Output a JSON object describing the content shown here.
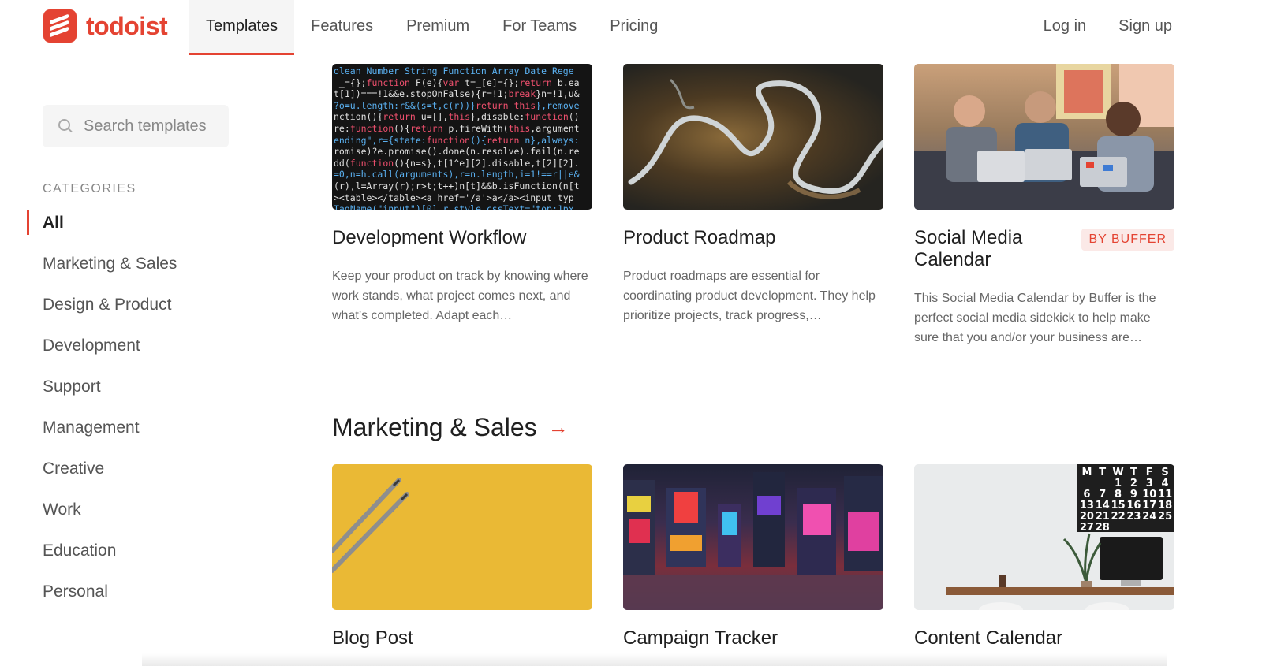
{
  "brand": {
    "name": "todoist",
    "color": "#e44332"
  },
  "nav": {
    "items": [
      {
        "label": "Templates",
        "active": true
      },
      {
        "label": "Features",
        "active": false
      },
      {
        "label": "Premium",
        "active": false
      },
      {
        "label": "For Teams",
        "active": false
      },
      {
        "label": "Pricing",
        "active": false
      }
    ],
    "login_label": "Log in",
    "signup_label": "Sign up"
  },
  "sidebar": {
    "search_placeholder": "Search templates",
    "categories_heading": "CATEGORIES",
    "categories": [
      {
        "label": "All",
        "active": true
      },
      {
        "label": "Marketing & Sales",
        "active": false
      },
      {
        "label": "Design & Product",
        "active": false
      },
      {
        "label": "Development",
        "active": false
      },
      {
        "label": "Support",
        "active": false
      },
      {
        "label": "Management",
        "active": false
      },
      {
        "label": "Creative",
        "active": false
      },
      {
        "label": "Work",
        "active": false
      },
      {
        "label": "Education",
        "active": false
      },
      {
        "label": "Personal",
        "active": false
      }
    ]
  },
  "top_cards": [
    {
      "title": "Development Workflow",
      "description": "Keep your product on track by knowing where work stands, what project comes next, and what’s completed. Adapt each…"
    },
    {
      "title": "Product Roadmap",
      "description": "Product roadmaps are essential for coordinating product development. They help prioritize projects, track progress,…"
    },
    {
      "title": "Social Media Calendar",
      "badge": "BY BUFFER",
      "description": "This Social Media Calendar by Buffer is the perfect social media sidekick to help make sure that you and/or your business are…"
    }
  ],
  "code_lines": [
    "olean Number String Function Array Date Rege",
    " _={};function F(e){var t=_[e]={};return b.ea",
    "t[1])===!1&&e.stopOnFalse){r=!1;break}n=!1,u&",
    "?o=u.length:r&&(s=t,c(r))}return this},remove",
    "nction(){return u=[],this},disable:function()",
    "re:function(){return p.fireWith(this,argument",
    "ending\",r={state:function(){return n},always:",
    "romise)?e.promise().done(n.resolve).fail(n.re",
    "dd(function(){n=s},t[1^e][2].disable,t[2][2].",
    "=0,n=h.call(arguments),r=n.length,i=1!==r||e&",
    "(r),l=Array(r);r>t;t++)n[t]&&b.isFunction(n[t",
    "><table></table><a href='/a'>a</a><input typ",
    "TagName(\"input\")[0],r.style.cssText=\"top:1px"
  ],
  "section": {
    "title": "Marketing & Sales",
    "arrow_icon": "arrow-right-icon"
  },
  "bottom_cards": [
    {
      "title": "Blog Post"
    },
    {
      "title": "Campaign Tracker"
    },
    {
      "title": "Content Calendar"
    }
  ],
  "calendar_days": {
    "header": [
      "M",
      "T",
      "W",
      "T",
      "F",
      "S"
    ],
    "rows": [
      [
        "",
        "",
        "1",
        "2",
        "3",
        "4"
      ],
      [
        "6",
        "7",
        "8",
        "9",
        "10",
        "11"
      ],
      [
        "13",
        "14",
        "15",
        "16",
        "17",
        "18"
      ],
      [
        "20",
        "21",
        "22",
        "23",
        "24",
        "25"
      ],
      [
        "27",
        "28",
        "",
        "",
        "",
        ""
      ]
    ]
  }
}
